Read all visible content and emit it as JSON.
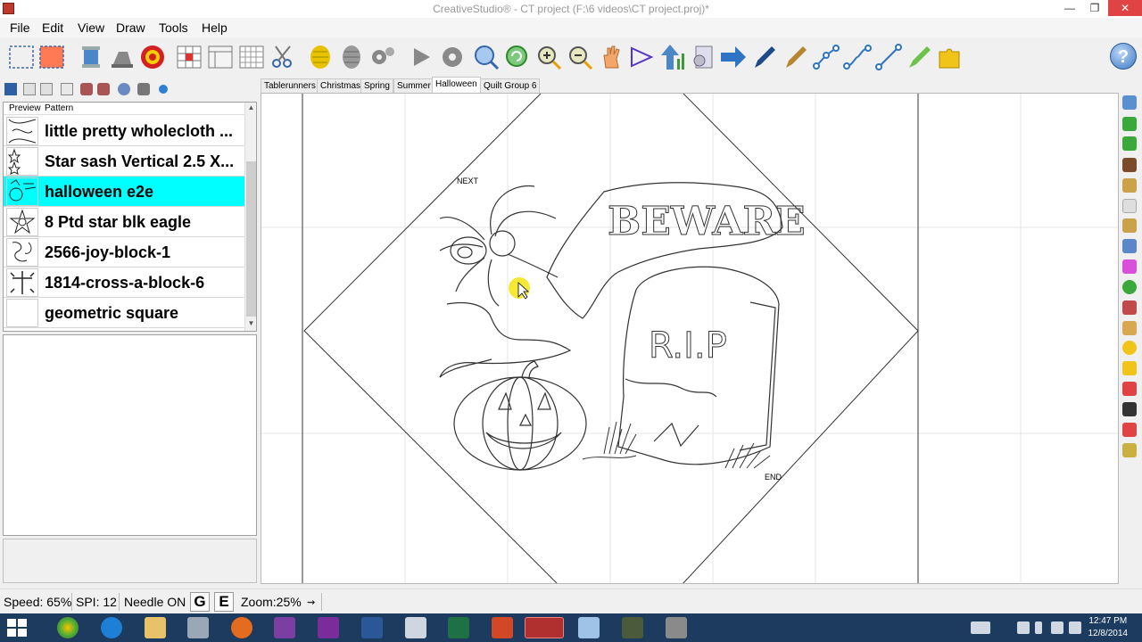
{
  "window": {
    "title": "CreativeStudio® - CT project (F:\\6 videos\\CT project.proj)*",
    "minimize_icon": "—",
    "maximize_icon": "❐",
    "close_icon": "✕"
  },
  "menu": [
    "File",
    "Edit",
    "View",
    "Draw",
    "Tools",
    "Help"
  ],
  "help_label": "?",
  "tabs": [
    "Tablerunners",
    "Christmas",
    "Spring",
    "Summer",
    "Halloween",
    "Quilt Group 6"
  ],
  "active_tab": "Halloween",
  "pattern_list": {
    "headers": {
      "preview": "Preview",
      "pattern": "Pattern"
    },
    "items": [
      {
        "name": "little pretty wholecloth ..."
      },
      {
        "name": "Star sash Vertical 2.5 X..."
      },
      {
        "name": "halloween e2e",
        "selected": true
      },
      {
        "name": "8 Ptd star blk eagle"
      },
      {
        "name": "2566-joy-block-1"
      },
      {
        "name": "1814-cross-a-block-6"
      },
      {
        "name": "geometric square"
      }
    ],
    "scroll_up": "▲",
    "scroll_down": "▼"
  },
  "canvas": {
    "start_label": "NEXT",
    "end_label": "END",
    "sign_text": "BEWARE",
    "tombstone_text": "R.I.P"
  },
  "status": {
    "speed": "Speed: 65%",
    "spi": "SPI: 12",
    "needle": "Needle ON",
    "g_btn": "G",
    "e_btn": "E",
    "zoom": "Zoom:25%",
    "zoom_arrow": "⇝"
  },
  "taskbar": {
    "time": "12:47 PM",
    "date": "12/8/2014"
  },
  "colors": {
    "selection": "#00ffff",
    "taskbar": "#1c3b5e",
    "close": "#e04343"
  }
}
